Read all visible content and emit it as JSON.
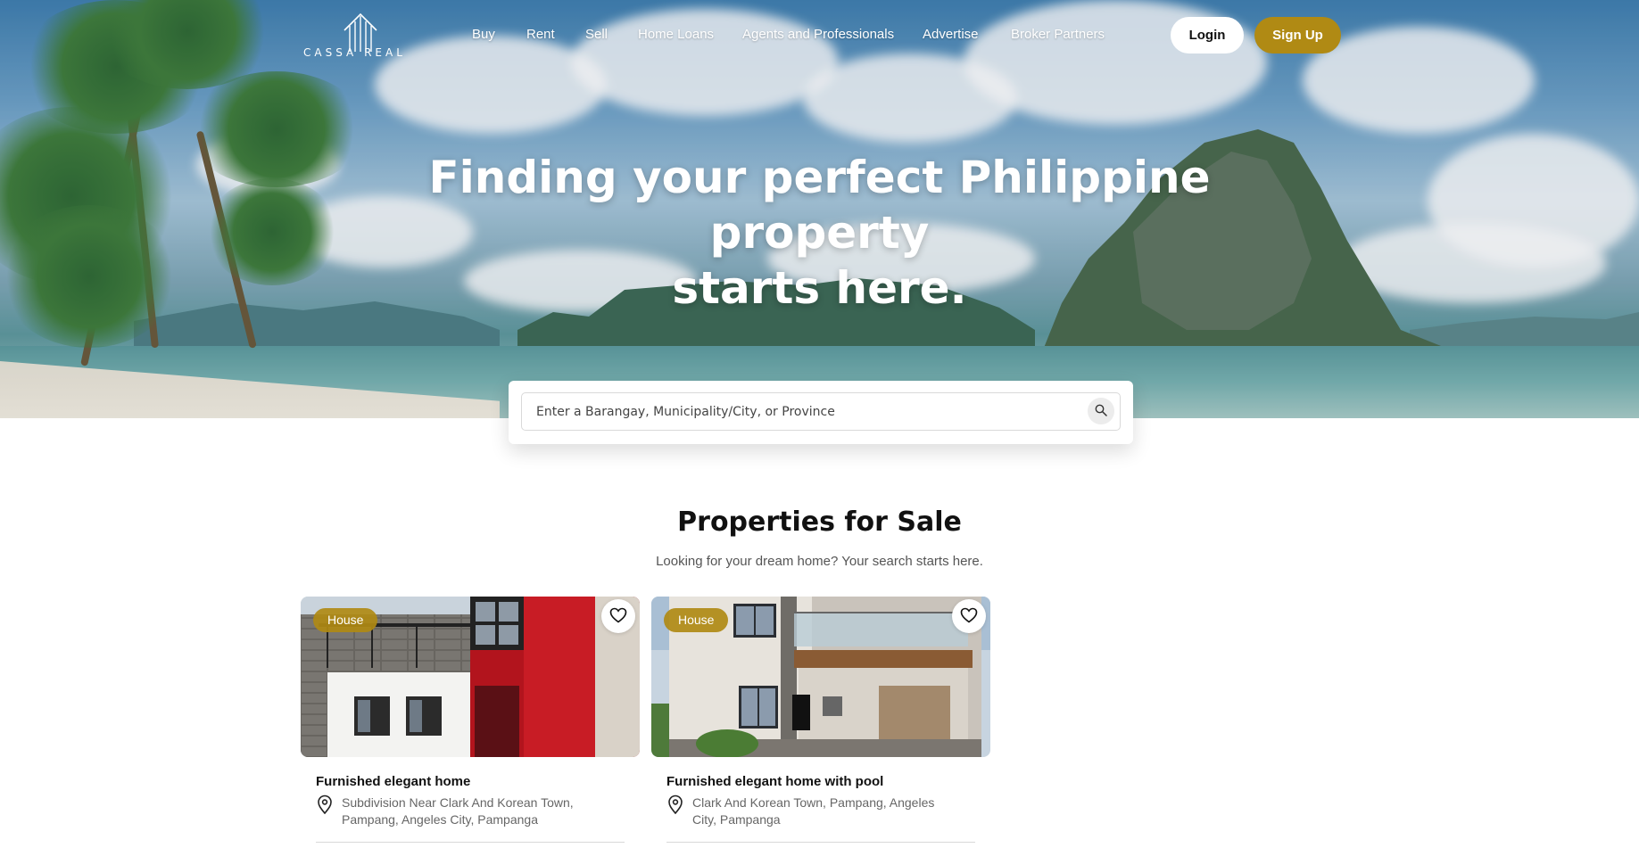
{
  "brand": {
    "logo_text": "CASSA REAL"
  },
  "nav": {
    "items": [
      "Buy",
      "Rent",
      "Sell",
      "Home Loans",
      "Agents and Professionals",
      "Advertise",
      "Broker Partners"
    ],
    "login": "Login",
    "signup": "Sign Up"
  },
  "hero": {
    "headline_line1": "Finding your perfect Philippine property",
    "headline_line2": "starts here."
  },
  "search": {
    "placeholder": "Enter a Barangay, Municipality/City, or Province",
    "icon": "search-icon"
  },
  "section": {
    "title": "Properties for Sale",
    "subtitle": "Looking for your dream home? Your search starts here."
  },
  "listings": [
    {
      "type": "House",
      "title": "Furnished elegant home",
      "address": "Subdivision Near Clark And Korean Town, Pampang, Angeles City, Pampanga"
    },
    {
      "type": "House",
      "title": "Furnished elegant home with pool",
      "address": "Clark And Korean Town, Pampang, Angeles City, Pampanga"
    }
  ],
  "colors": {
    "accent": "#b08a14",
    "text": "#111111",
    "muted": "#666666"
  }
}
